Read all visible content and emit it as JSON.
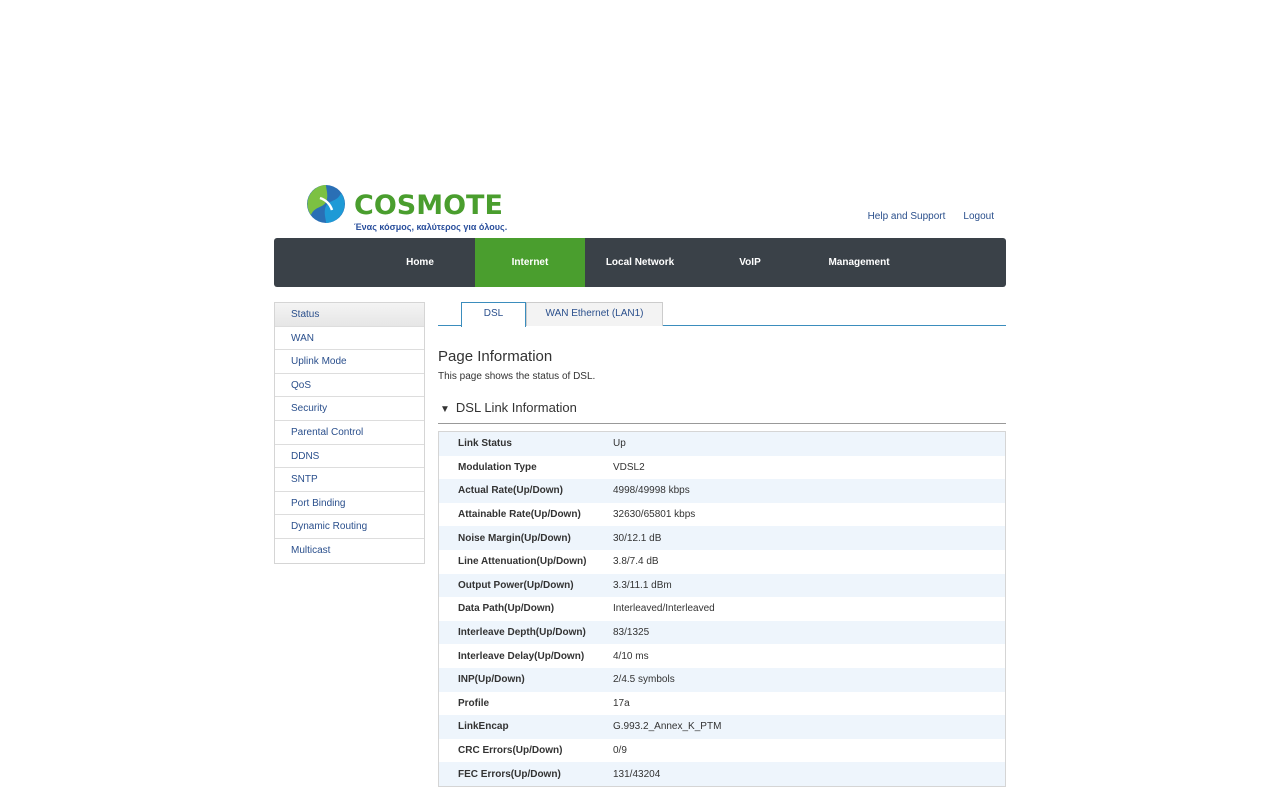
{
  "brand": {
    "name": "COSMOTE",
    "tagline": "Ένας κόσμος, καλύτερος για όλους.",
    "color": "#4a9e2e"
  },
  "top_links": [
    "Help and Support",
    "Logout"
  ],
  "nav": {
    "items": [
      "Home",
      "Internet",
      "Local Network",
      "VoIP",
      "Management"
    ],
    "active": "Internet"
  },
  "sidebar": {
    "items": [
      "Status",
      "WAN",
      "Uplink Mode",
      "QoS",
      "Security",
      "Parental Control",
      "DDNS",
      "SNTP",
      "Port Binding",
      "Dynamic Routing",
      "Multicast"
    ],
    "active": "Status"
  },
  "tabs": {
    "items": [
      "DSL",
      "WAN Ethernet (LAN1)"
    ],
    "active": "DSL"
  },
  "page": {
    "title": "Page Information",
    "description": "This page shows the status of DSL."
  },
  "section": {
    "title": "DSL Link Information",
    "icon": "triangle-down-icon"
  },
  "rows": [
    {
      "k": "Link Status",
      "v": "Up"
    },
    {
      "k": "Modulation Type",
      "v": "VDSL2"
    },
    {
      "k": "Actual Rate(Up/Down)",
      "v": "4998/49998 kbps"
    },
    {
      "k": "Attainable Rate(Up/Down)",
      "v": "32630/65801 kbps"
    },
    {
      "k": "Noise Margin(Up/Down)",
      "v": "30/12.1 dB"
    },
    {
      "k": "Line Attenuation(Up/Down)",
      "v": "3.8/7.4 dB"
    },
    {
      "k": "Output Power(Up/Down)",
      "v": "3.3/11.1 dBm"
    },
    {
      "k": "Data Path(Up/Down)",
      "v": "Interleaved/Interleaved"
    },
    {
      "k": "Interleave Depth(Up/Down)",
      "v": "83/1325"
    },
    {
      "k": "Interleave Delay(Up/Down)",
      "v": "4/10 ms"
    },
    {
      "k": "INP(Up/Down)",
      "v": "2/4.5 symbols"
    },
    {
      "k": "Profile",
      "v": "17a"
    },
    {
      "k": "LinkEncap",
      "v": "G.993.2_Annex_K_PTM"
    },
    {
      "k": "CRC Errors(Up/Down)",
      "v": "0/9"
    },
    {
      "k": "FEC Errors(Up/Down)",
      "v": "131/43204"
    }
  ]
}
